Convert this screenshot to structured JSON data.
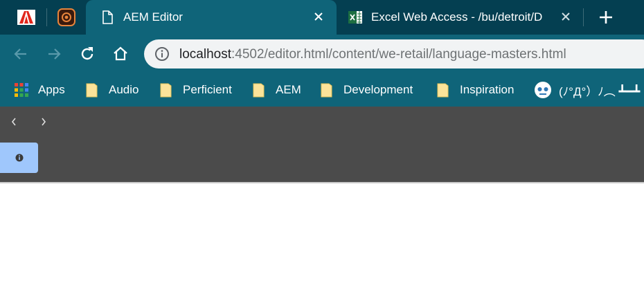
{
  "tabs": {
    "pinned": [
      {
        "name": "Adobe",
        "icon": "adobe-logo-icon"
      },
      {
        "name": "AEM",
        "icon": "aem-logo-icon"
      }
    ],
    "active": {
      "title": "AEM Editor",
      "icon": "page-icon"
    },
    "inactive": {
      "title": "Excel Web Access - /bu/detroit/D",
      "icon": "excel-icon"
    }
  },
  "toolbar": {
    "url_host": "localhost",
    "url_rest": ":4502/editor.html/content/we-retail/language-masters.html"
  },
  "bookmarks": [
    {
      "label": "Apps",
      "icon": "apps-grid-icon"
    },
    {
      "label": "Audio",
      "icon": "folder-icon"
    },
    {
      "label": "Perficient",
      "icon": "folder-icon"
    },
    {
      "label": "AEM",
      "icon": "folder-icon"
    },
    {
      "label": "Development",
      "icon": "folder-icon"
    },
    {
      "label": "Inspiration",
      "icon": "folder-icon"
    },
    {
      "label": "(ﾉ°Д°）ﾉ︵ ┻━┻",
      "icon": "skull-icon"
    }
  ],
  "colors": {
    "tabstrip": "#043f51",
    "toolbar": "#0f6479",
    "editor_bar": "#4b4b4b",
    "info_button": "#9fc7fc",
    "folder": "#fbe39a"
  }
}
